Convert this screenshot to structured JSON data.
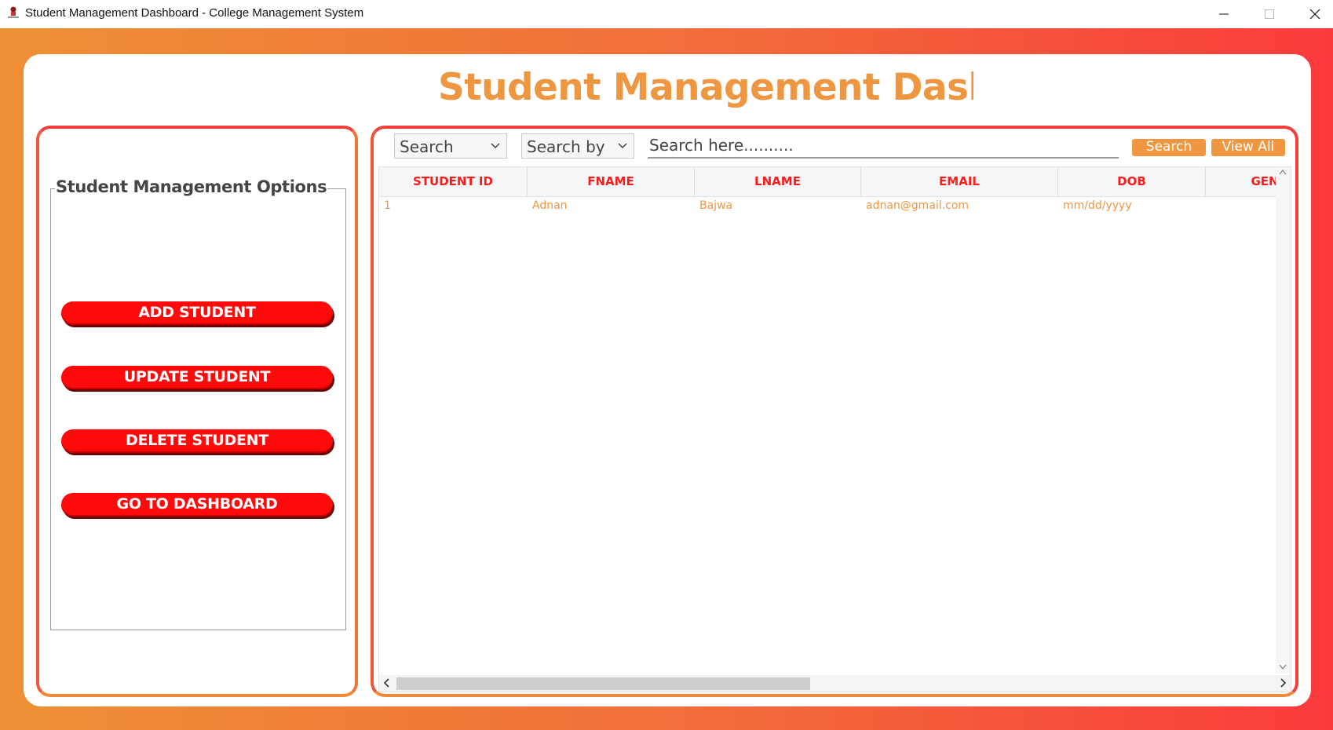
{
  "window": {
    "title": "Student Management Dashboard - College Management System"
  },
  "page": {
    "heading": "Student Management Dashbo"
  },
  "options": {
    "legend": "Student Management Options",
    "buttons": {
      "add": "ADD STUDENT",
      "update": "UPDATE STUDENT",
      "delete": "DELETE STUDENT",
      "dashboard": "GO TO DASHBOARD"
    }
  },
  "toolbar": {
    "combo1": "Search",
    "combo2": "Search by",
    "search_placeholder": "Search here..........",
    "search_button": "Search",
    "view_all_button": "View All"
  },
  "table": {
    "columns": [
      "STUDENT ID",
      "FNAME",
      "LNAME",
      "EMAIL",
      "DOB",
      "GEN"
    ],
    "rows": [
      [
        "1",
        "Adnan",
        "Bajwa",
        "adnan@gmail.com",
        "mm/dd/yyyy",
        ""
      ]
    ]
  },
  "colors": {
    "accent_orange": "#ef9640",
    "button_red": "#ff0a0a",
    "gradient_start": "#ee9035",
    "gradient_end": "#fb3a3c"
  },
  "icons": {
    "app": "app-logo-icon",
    "minimize": "minimize-icon",
    "maximize": "maximize-icon",
    "close": "close-icon"
  }
}
